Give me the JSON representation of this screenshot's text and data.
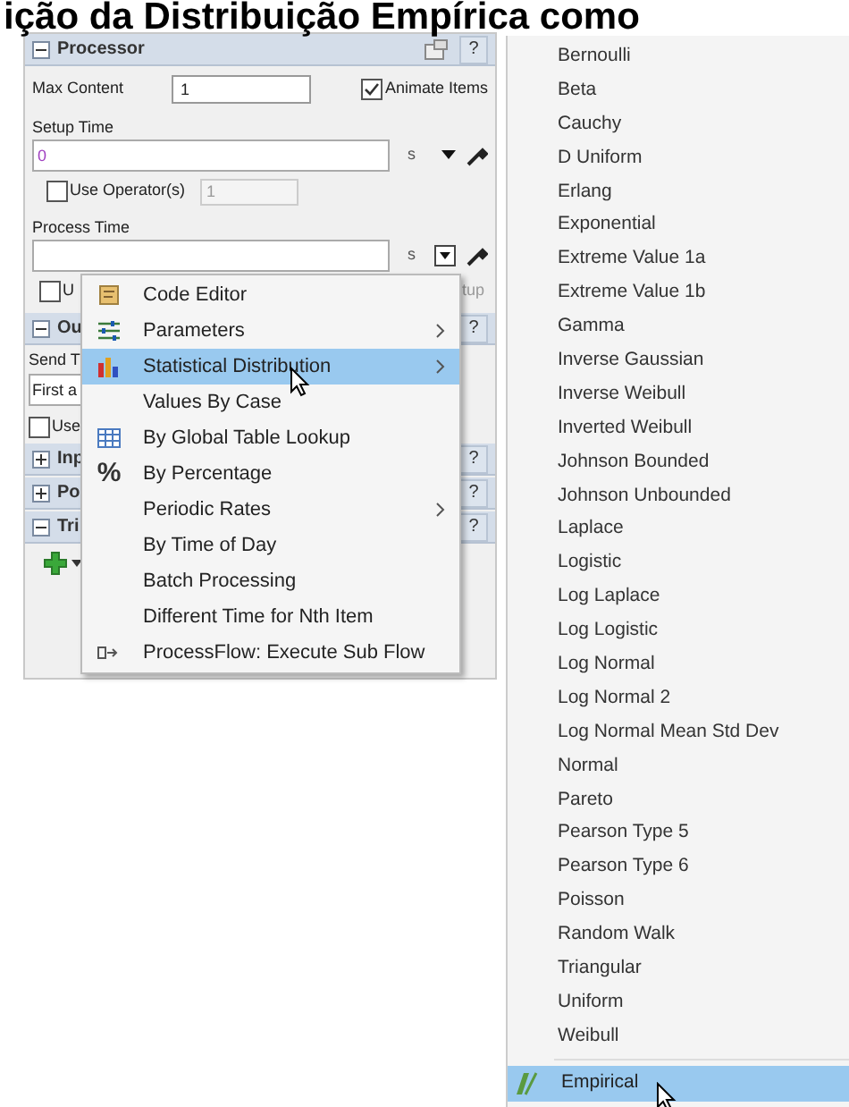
{
  "title_overlay": "ição da Distribuição Empírica como",
  "help_label": "?",
  "panel": {
    "title": "Processor",
    "expanded": true,
    "max_content": {
      "label": "Max Content",
      "value": "1"
    },
    "animate_items": {
      "label": "Animate Items",
      "checked": true
    },
    "setup_time": {
      "label": "Setup Time",
      "value": "0",
      "unit": "s"
    },
    "use_operator": {
      "label": "Use Operator(s)",
      "checked": false,
      "value": "1"
    },
    "process_time": {
      "label": "Process Time",
      "unit": "s"
    },
    "covered_row": {
      "label": "U",
      "checked": false,
      "trailing": "tup"
    },
    "output": {
      "title": "Ou",
      "expanded": true,
      "send_to_label": "Send T",
      "send_to_value": "First a",
      "use_label": "Use",
      "use_checked": false
    },
    "sections": [
      {
        "title": "Inp",
        "expanded": false
      },
      {
        "title": "Po",
        "expanded": false
      },
      {
        "title": "Tri",
        "expanded": true
      }
    ]
  },
  "context_menu": [
    {
      "label": "Code Editor",
      "kind": "editor",
      "submenu": false,
      "selected": false
    },
    {
      "label": "Parameters",
      "kind": "sliders",
      "submenu": true,
      "selected": false
    },
    {
      "label": "Statistical Distribution",
      "kind": "chart",
      "submenu": true,
      "selected": true
    },
    {
      "label": "Values By Case",
      "kind": "plain",
      "submenu": false,
      "selected": false
    },
    {
      "label": "By Global Table Lookup",
      "kind": "table",
      "submenu": false,
      "selected": false
    },
    {
      "label": "By Percentage",
      "kind": "percent",
      "icon_text": "%",
      "submenu": false,
      "selected": false
    },
    {
      "label": "Periodic Rates",
      "kind": "plain",
      "submenu": true,
      "selected": false
    },
    {
      "label": "By Time of Day",
      "kind": "plain",
      "submenu": false,
      "selected": false
    },
    {
      "label": "Batch Processing",
      "kind": "plain",
      "submenu": false,
      "selected": false
    },
    {
      "label": "Different Time for Nth Item",
      "kind": "plain",
      "submenu": false,
      "selected": false
    },
    {
      "label": "ProcessFlow: Execute Sub Flow",
      "kind": "flow",
      "submenu": false,
      "selected": false
    }
  ],
  "distributions": [
    {
      "label": "Bernoulli",
      "selected": false
    },
    {
      "label": "Beta",
      "selected": false
    },
    {
      "label": "Cauchy",
      "selected": false
    },
    {
      "label": "D Uniform",
      "selected": false
    },
    {
      "label": "Erlang",
      "selected": false
    },
    {
      "label": "Exponential",
      "selected": false
    },
    {
      "label": "Extreme Value 1a",
      "selected": false
    },
    {
      "label": "Extreme Value 1b",
      "selected": false
    },
    {
      "label": "Gamma",
      "selected": false
    },
    {
      "label": "Inverse Gaussian",
      "selected": false
    },
    {
      "label": "Inverse Weibull",
      "selected": false
    },
    {
      "label": "Inverted Weibull",
      "selected": false
    },
    {
      "label": "Johnson Bounded",
      "selected": false
    },
    {
      "label": "Johnson Unbounded",
      "selected": false
    },
    {
      "label": "Laplace",
      "selected": false
    },
    {
      "label": "Logistic",
      "selected": false
    },
    {
      "label": "Log Laplace",
      "selected": false
    },
    {
      "label": "Log Logistic",
      "selected": false
    },
    {
      "label": "Log Normal",
      "selected": false
    },
    {
      "label": "Log Normal 2",
      "selected": false
    },
    {
      "label": "Log Normal Mean Std Dev",
      "selected": false
    },
    {
      "label": "Normal",
      "selected": false
    },
    {
      "label": "Pareto",
      "selected": false
    },
    {
      "label": "Pearson Type 5",
      "selected": false
    },
    {
      "label": "Pearson Type 6",
      "selected": false
    },
    {
      "label": "Poisson",
      "selected": false
    },
    {
      "label": "Random Walk",
      "selected": false
    },
    {
      "label": "Triangular",
      "selected": false
    },
    {
      "label": "Uniform",
      "selected": false
    },
    {
      "label": "Weibull",
      "selected": false
    }
  ],
  "custom_distribution": {
    "label": "Empirical",
    "selected": true
  }
}
